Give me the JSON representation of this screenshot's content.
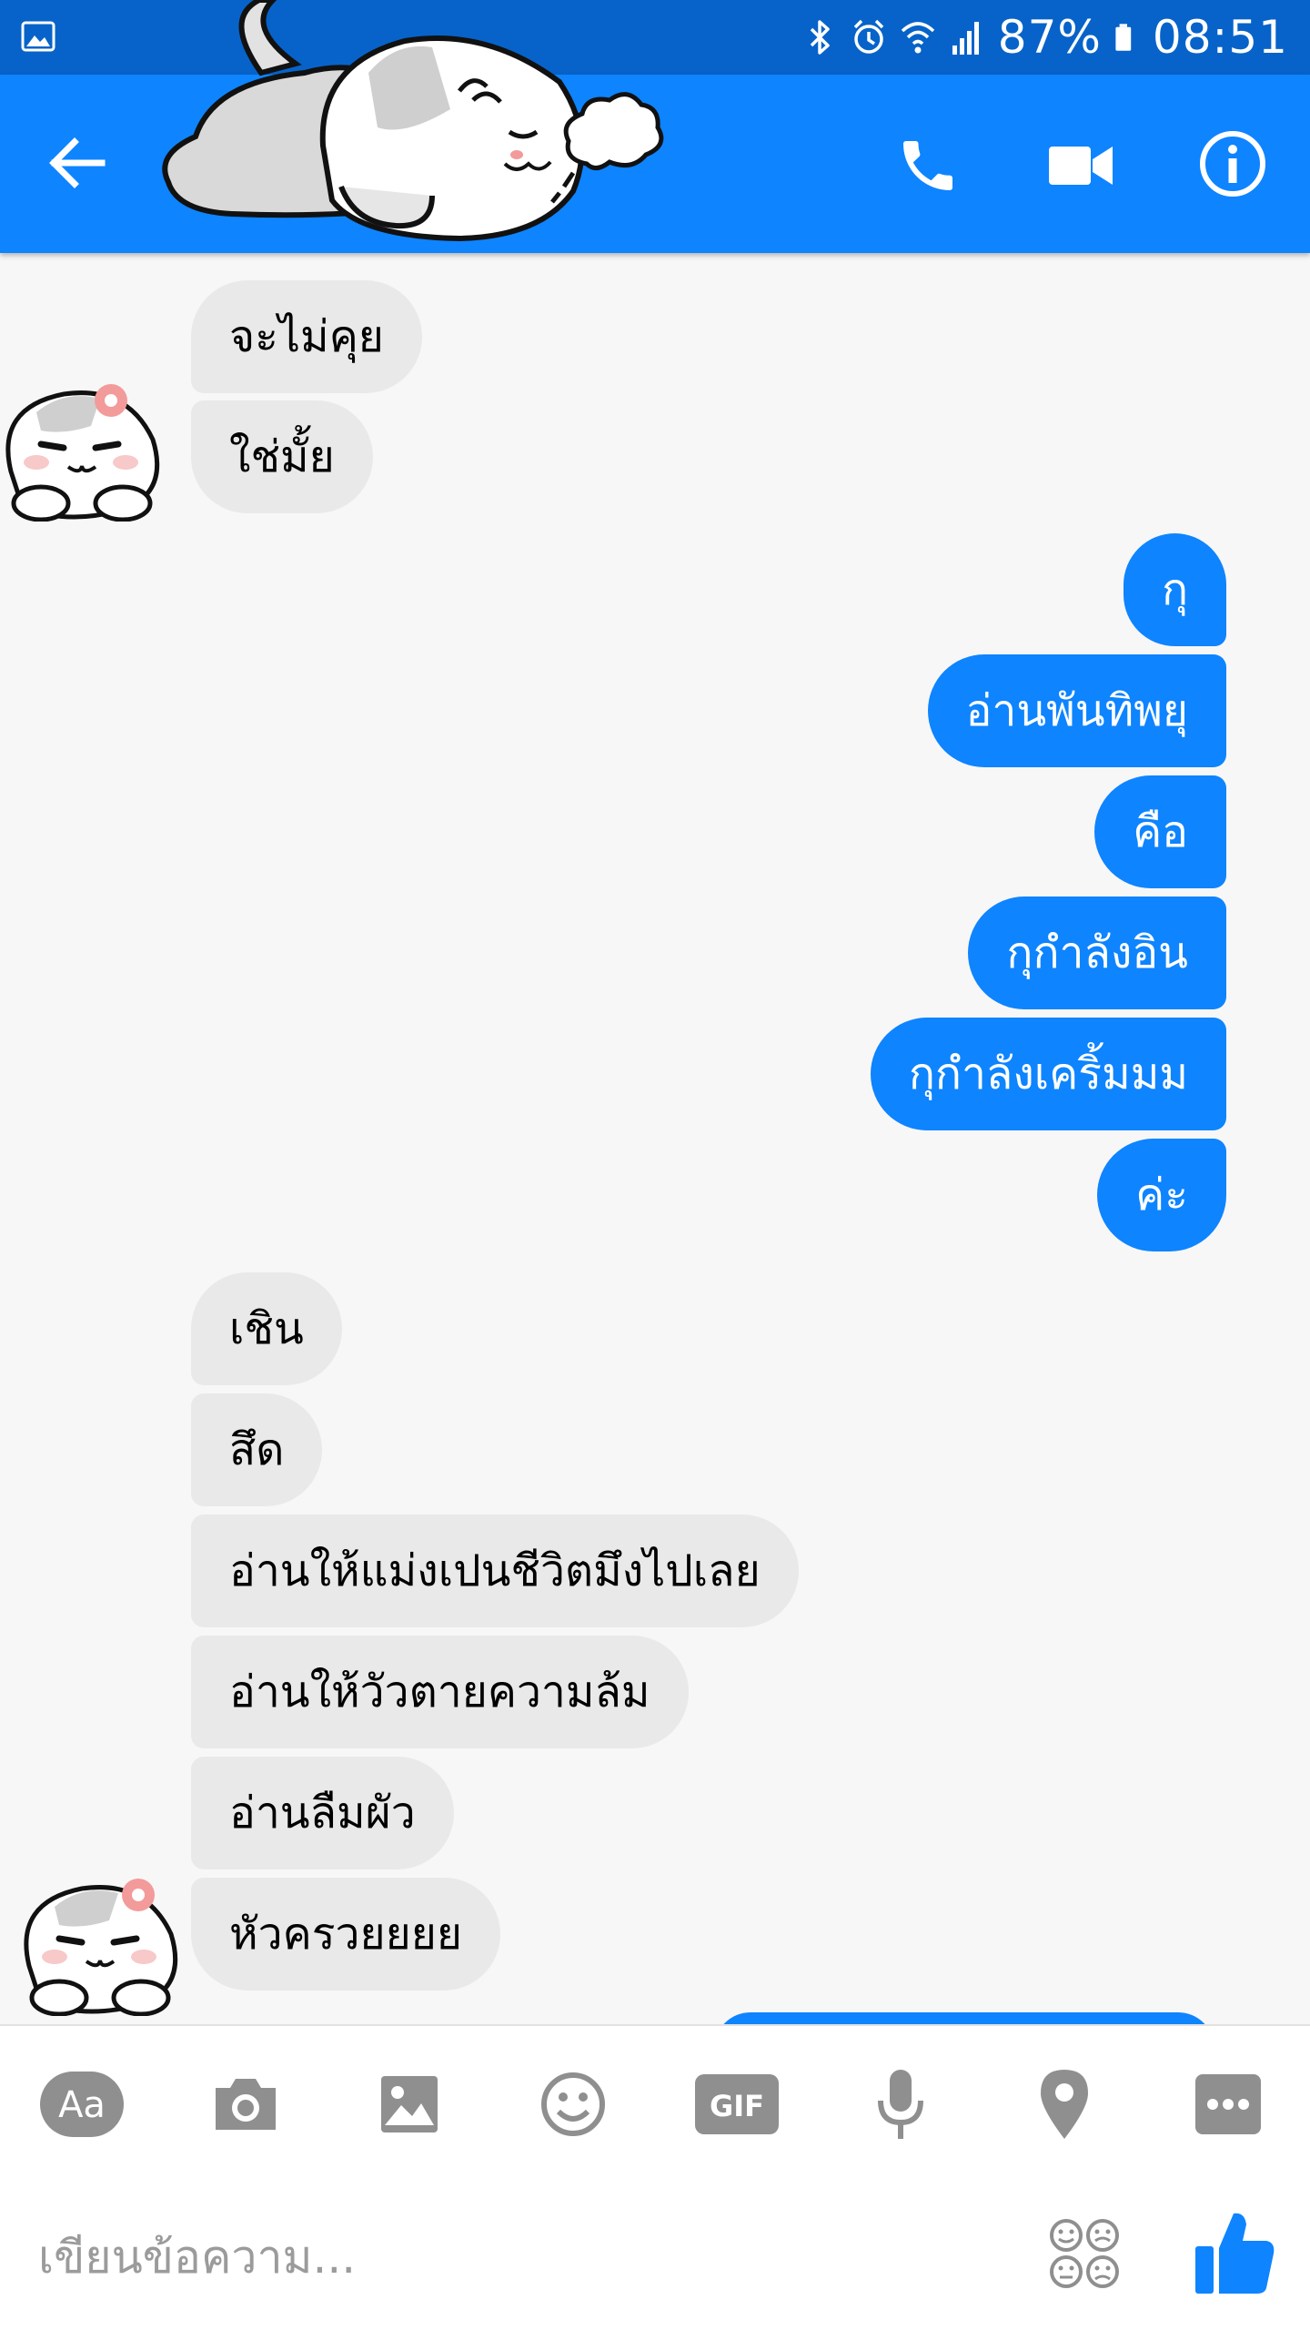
{
  "status_bar": {
    "battery": "87%",
    "time": "08:51",
    "icons": [
      "gallery-icon",
      "bluetooth-icon",
      "alarm-icon",
      "wifi-icon",
      "signal-icon",
      "battery-icon"
    ]
  },
  "header": {
    "icons": [
      "back-arrow-icon",
      "phone-icon",
      "video-camera-icon",
      "info-icon"
    ]
  },
  "conversation": {
    "messages": [
      {
        "side": "in",
        "text": "จะไม่คุย"
      },
      {
        "side": "in",
        "text": "ใช่มั้ย"
      },
      {
        "side": "out",
        "text": "กุ"
      },
      {
        "side": "out",
        "text": "อ่านพันทิพยุ"
      },
      {
        "side": "out",
        "text": "คือ"
      },
      {
        "side": "out",
        "text": "กุกำลังอิน"
      },
      {
        "side": "out",
        "text": "กุกำลังเคริ้มมม"
      },
      {
        "side": "out",
        "text": "ค่ะ"
      },
      {
        "side": "in",
        "text": "เชิน"
      },
      {
        "side": "in",
        "text": "สึด"
      },
      {
        "side": "in",
        "text": "อ่านให้แม่งเปนชีวิตมึงไปเลย"
      },
      {
        "side": "in",
        "text": "อ่านให้วัวตายความล้ม"
      },
      {
        "side": "in",
        "text": "อ่านลืมผัว"
      },
      {
        "side": "in",
        "text": "หัวครวยยยย"
      }
    ]
  },
  "toolbar": {
    "text_tool_label": "Aa",
    "gif_label": "GIF",
    "icons": [
      "text-format-icon",
      "camera-icon",
      "image-icon",
      "emoji-icon",
      "gif-icon",
      "microphone-icon",
      "location-pin-icon",
      "more-icon"
    ]
  },
  "composer": {
    "placeholder": "เขียนข้อความ...",
    "icons": [
      "sticker-faces-icon",
      "thumbs-up-icon"
    ]
  },
  "colors": {
    "status_bar": "#0763c9",
    "accent": "#0e84ff",
    "incoming_bubble": "#e9e9e9",
    "background": "#f7f7f7",
    "toolbar_icon": "#8f8f8f"
  }
}
